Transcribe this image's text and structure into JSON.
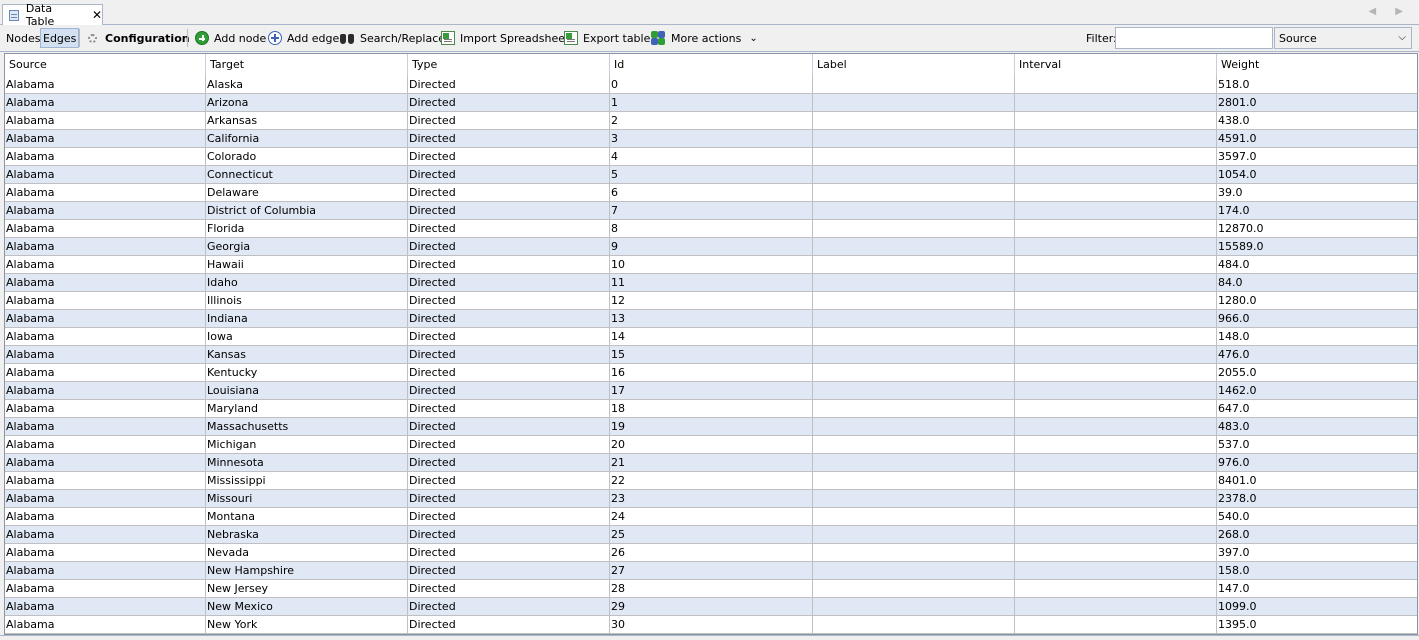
{
  "tab": {
    "label": "Data Table",
    "close": "✕"
  },
  "nav": {
    "arrows": "◀ ▶"
  },
  "toolbar": {
    "nodes": "Nodes",
    "edges": "Edges",
    "configuration": "Configuration",
    "add_node": "Add node",
    "add_edge": "Add edge",
    "search_replace": "Search/Replace",
    "import_spreadsheet": "Import Spreadsheet",
    "export_table": "Export table",
    "more_actions": "More actions",
    "filter_label": "Filter:",
    "filter_value": "",
    "filter_column": "Source"
  },
  "colors": {
    "alt_row": "#dfe8f4",
    "active_toggle": "#d3e0f1"
  },
  "table": {
    "columns": [
      "Source",
      "Target",
      "Type",
      "Id",
      "Label",
      "Interval",
      "Weight"
    ],
    "rows": [
      [
        "Alabama",
        "Alaska",
        "Directed",
        "0",
        "",
        "",
        "518.0"
      ],
      [
        "Alabama",
        "Arizona",
        "Directed",
        "1",
        "",
        "",
        "2801.0"
      ],
      [
        "Alabama",
        "Arkansas",
        "Directed",
        "2",
        "",
        "",
        "438.0"
      ],
      [
        "Alabama",
        "California",
        "Directed",
        "3",
        "",
        "",
        "4591.0"
      ],
      [
        "Alabama",
        "Colorado",
        "Directed",
        "4",
        "",
        "",
        "3597.0"
      ],
      [
        "Alabama",
        "Connecticut",
        "Directed",
        "5",
        "",
        "",
        "1054.0"
      ],
      [
        "Alabama",
        "Delaware",
        "Directed",
        "6",
        "",
        "",
        "39.0"
      ],
      [
        "Alabama",
        "District of Columbia",
        "Directed",
        "7",
        "",
        "",
        "174.0"
      ],
      [
        "Alabama",
        "Florida",
        "Directed",
        "8",
        "",
        "",
        "12870.0"
      ],
      [
        "Alabama",
        "Georgia",
        "Directed",
        "9",
        "",
        "",
        "15589.0"
      ],
      [
        "Alabama",
        "Hawaii",
        "Directed",
        "10",
        "",
        "",
        "484.0"
      ],
      [
        "Alabama",
        "Idaho",
        "Directed",
        "11",
        "",
        "",
        "84.0"
      ],
      [
        "Alabama",
        "Illinois",
        "Directed",
        "12",
        "",
        "",
        "1280.0"
      ],
      [
        "Alabama",
        "Indiana",
        "Directed",
        "13",
        "",
        "",
        "966.0"
      ],
      [
        "Alabama",
        "Iowa",
        "Directed",
        "14",
        "",
        "",
        "148.0"
      ],
      [
        "Alabama",
        "Kansas",
        "Directed",
        "15",
        "",
        "",
        "476.0"
      ],
      [
        "Alabama",
        "Kentucky",
        "Directed",
        "16",
        "",
        "",
        "2055.0"
      ],
      [
        "Alabama",
        "Louisiana",
        "Directed",
        "17",
        "",
        "",
        "1462.0"
      ],
      [
        "Alabama",
        "Maryland",
        "Directed",
        "18",
        "",
        "",
        "647.0"
      ],
      [
        "Alabama",
        "Massachusetts",
        "Directed",
        "19",
        "",
        "",
        "483.0"
      ],
      [
        "Alabama",
        "Michigan",
        "Directed",
        "20",
        "",
        "",
        "537.0"
      ],
      [
        "Alabama",
        "Minnesota",
        "Directed",
        "21",
        "",
        "",
        "976.0"
      ],
      [
        "Alabama",
        "Mississippi",
        "Directed",
        "22",
        "",
        "",
        "8401.0"
      ],
      [
        "Alabama",
        "Missouri",
        "Directed",
        "23",
        "",
        "",
        "2378.0"
      ],
      [
        "Alabama",
        "Montana",
        "Directed",
        "24",
        "",
        "",
        "540.0"
      ],
      [
        "Alabama",
        "Nebraska",
        "Directed",
        "25",
        "",
        "",
        "268.0"
      ],
      [
        "Alabama",
        "Nevada",
        "Directed",
        "26",
        "",
        "",
        "397.0"
      ],
      [
        "Alabama",
        "New Hampshire",
        "Directed",
        "27",
        "",
        "",
        "158.0"
      ],
      [
        "Alabama",
        "New Jersey",
        "Directed",
        "28",
        "",
        "",
        "147.0"
      ],
      [
        "Alabama",
        "New Mexico",
        "Directed",
        "29",
        "",
        "",
        "1099.0"
      ],
      [
        "Alabama",
        "New York",
        "Directed",
        "30",
        "",
        "",
        "1395.0"
      ]
    ]
  }
}
